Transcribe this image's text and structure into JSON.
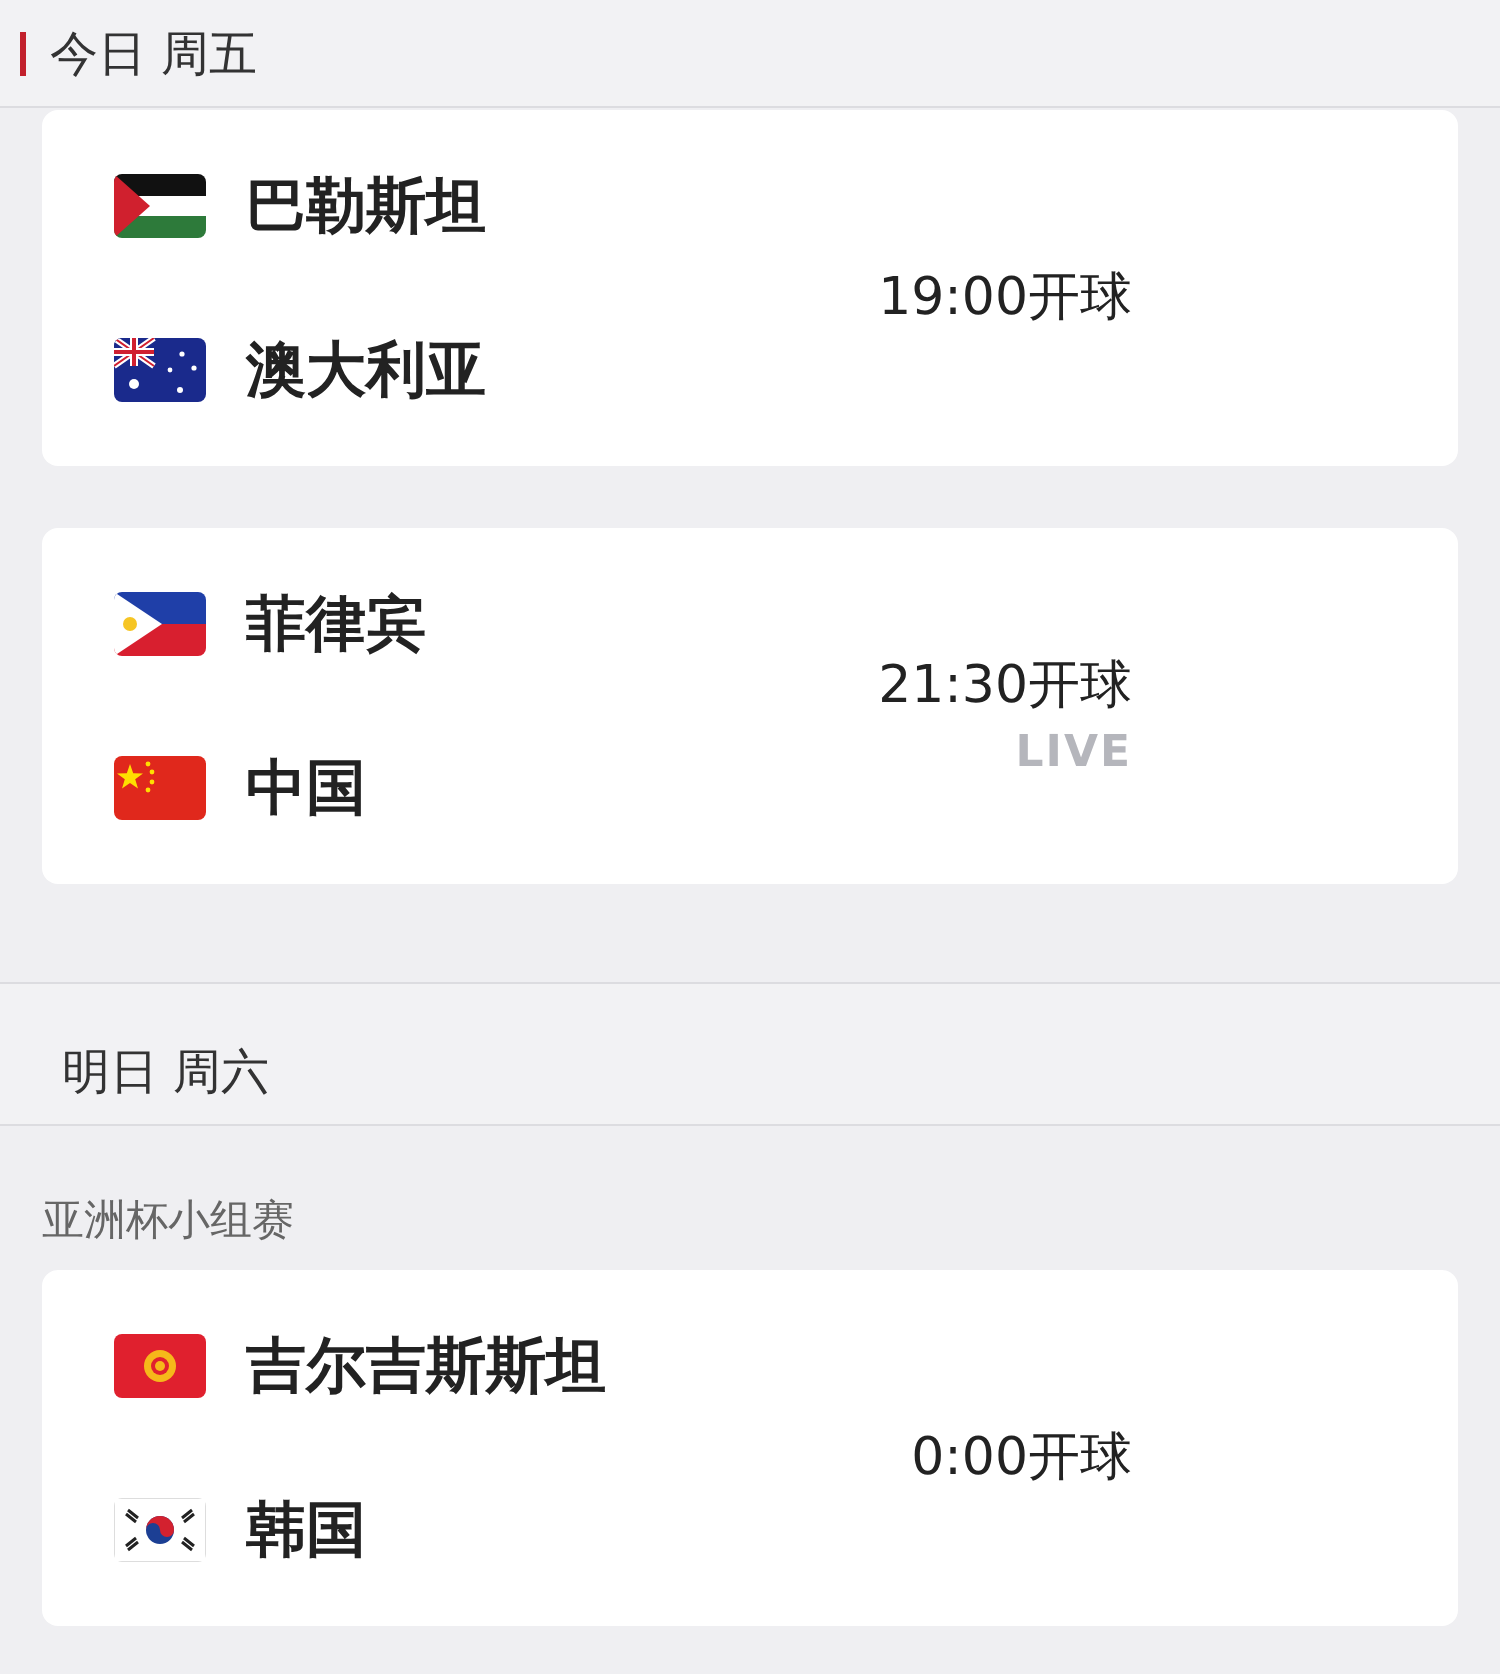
{
  "days": [
    {
      "title": "今日 周五",
      "marked": true,
      "matches": [
        {
          "teams": [
            {
              "name": "巴勒斯坦"
            },
            {
              "name": "澳大利亚"
            }
          ],
          "time": "19:00开球"
        },
        {
          "teams": [
            {
              "name": "菲律宾"
            },
            {
              "name": "中国"
            }
          ],
          "time": "21:30开球",
          "status": "LIVE"
        }
      ]
    },
    {
      "title": "明日 周六",
      "marked": false,
      "competition": "亚洲杯小组赛",
      "matches": [
        {
          "teams": [
            {
              "name": "吉尔吉斯斯坦"
            },
            {
              "name": "韩国"
            }
          ],
          "time": "0:00开球"
        }
      ]
    }
  ]
}
